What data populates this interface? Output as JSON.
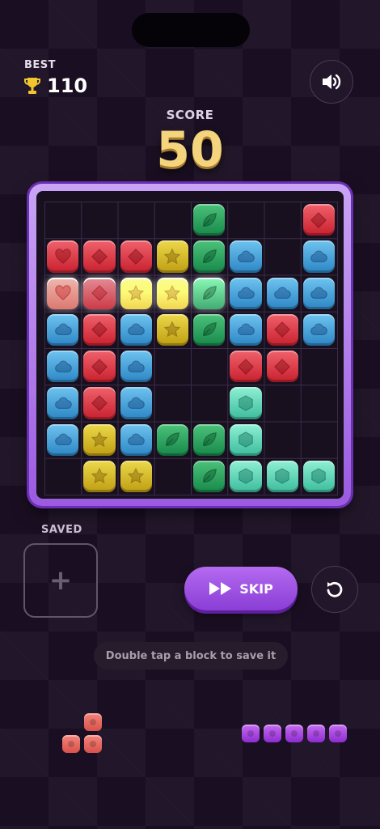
{
  "best": {
    "label": "BEST",
    "value": "110"
  },
  "score": {
    "label": "SCORE",
    "value": "50"
  },
  "saved": {
    "label": "SAVED"
  },
  "skip": {
    "label": "SKIP"
  },
  "hint": {
    "text": "Double tap a block to save it"
  },
  "colors": {
    "red": "#d9333f",
    "blue": "#3b9fd8",
    "yellow": "#d6bd25",
    "green": "#22a05c",
    "teal": "#5fd6b6",
    "salmon": "#e8665c",
    "purple": "#a24de3"
  },
  "board": {
    "rows": 8,
    "cols": 8,
    "grid": [
      [
        "",
        "",
        "",
        "",
        "green:leaf",
        "",
        "",
        "red:diamond"
      ],
      [
        "red:heart",
        "red:diamond",
        "red:diamond",
        "yellow:star",
        "green:leaf",
        "blue:cloud",
        "",
        "blue:cloud"
      ],
      [
        "salmon:heart:glow",
        "red:diamond:glow",
        "yellow:star:glow",
        "yellow:star:glow",
        "green:leaf:glow",
        "blue:cloud",
        "blue:cloud",
        "blue:cloud"
      ],
      [
        "blue:cloud",
        "red:diamond",
        "blue:cloud",
        "yellow:star",
        "green:leaf",
        "blue:cloud",
        "red:diamond",
        "blue:cloud"
      ],
      [
        "blue:cloud",
        "red:diamond",
        "blue:cloud",
        "",
        "",
        "red:diamond",
        "red:diamond",
        ""
      ],
      [
        "blue:cloud",
        "red:diamond",
        "blue:cloud",
        "",
        "",
        "teal:hexagon",
        "",
        ""
      ],
      [
        "blue:cloud",
        "yellow:star",
        "blue:cloud",
        "green:leaf",
        "green:leaf",
        "teal:hexagon",
        "",
        ""
      ],
      [
        "",
        "yellow:star",
        "yellow:star",
        "",
        "green:leaf",
        "teal:hexagon",
        "teal:hexagon",
        "teal:hexagon"
      ]
    ]
  },
  "pieces": [
    {
      "name": "salmon-t-piece",
      "color": "salmon"
    },
    {
      "name": "purple-line-piece",
      "color": "purple",
      "length": 5
    }
  ]
}
